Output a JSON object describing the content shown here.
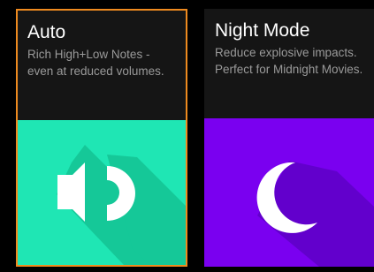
{
  "modes": [
    {
      "title": "Auto",
      "description": "Rich High+Low Notes - even at reduced volumes.",
      "icon": "speaker-icon",
      "tile_color": "#1fe6b4",
      "selected": true
    },
    {
      "title": "Night Mode",
      "description": "Reduce explosive impacts. Perfect for Midnight Movies.",
      "icon": "moon-icon",
      "tile_color": "#7a00f0",
      "selected": false
    }
  ],
  "colors": {
    "background": "#000000",
    "card_background": "#151515",
    "selection_border": "#ee8a1f",
    "title_text": "#ffffff",
    "description_text": "#9a9a9a",
    "icon": "#ffffff"
  }
}
